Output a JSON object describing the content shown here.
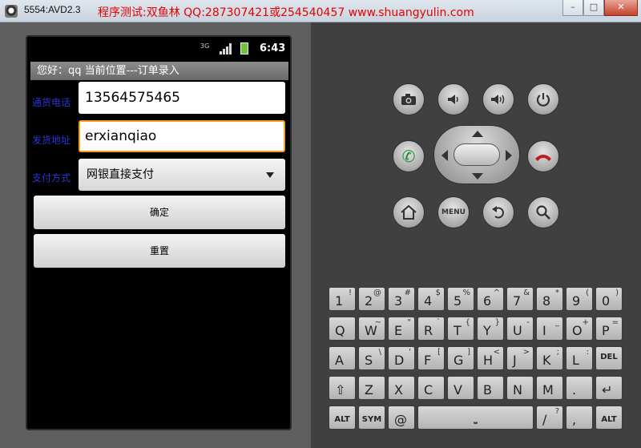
{
  "window": {
    "title": "5554:AVD2.3",
    "watermark": "程序测试:双鱼林 QQ:287307421或254540457 www.shuangyulin.com",
    "minimize": "–",
    "maximize": "□",
    "close": "✕"
  },
  "status_bar": {
    "network": "3G",
    "time": "6:43"
  },
  "app": {
    "title": "您好：qq   当前位置---订单录入",
    "phone_label": "通货电话",
    "phone_value": "13564575465",
    "address_label": "发货地址",
    "address_value": "erxianqiao",
    "payment_label": "支付方式",
    "payment_selected": "网银直接支付",
    "confirm_label": "确定",
    "reset_label": "重置"
  },
  "controls": {
    "menu_label": "MENU",
    "camera_icon": "camera-icon",
    "volume_down_icon": "volume-down-icon",
    "volume_up_icon": "volume-up-icon",
    "power_icon": "power-icon",
    "call_icon": "call-icon",
    "end_call_icon": "end-call-icon",
    "home_icon": "home-icon",
    "back_icon": "back-icon",
    "search_icon": "search-icon"
  },
  "keyboard": {
    "row1": [
      [
        "1",
        "!"
      ],
      [
        "2",
        "@"
      ],
      [
        "3",
        "#"
      ],
      [
        "4",
        "$"
      ],
      [
        "5",
        "%"
      ],
      [
        "6",
        "^"
      ],
      [
        "7",
        "&"
      ],
      [
        "8",
        "*"
      ],
      [
        "9",
        "("
      ],
      [
        "0",
        ")"
      ]
    ],
    "row2": [
      [
        "Q",
        ""
      ],
      [
        "W",
        "~"
      ],
      [
        "E",
        "\""
      ],
      [
        "R",
        "`"
      ],
      [
        "T",
        "{"
      ],
      [
        "Y",
        "}"
      ],
      [
        "U",
        "-"
      ],
      [
        "I",
        "_"
      ],
      [
        "O",
        "+"
      ],
      [
        "P",
        "="
      ]
    ],
    "row3": [
      [
        "A",
        ""
      ],
      [
        "S",
        "\\"
      ],
      [
        "D",
        "'"
      ],
      [
        "F",
        "["
      ],
      [
        "G",
        "]"
      ],
      [
        "H",
        "<"
      ],
      [
        "J",
        ">"
      ],
      [
        "K",
        ";"
      ],
      [
        "L",
        ":"
      ],
      [
        "DEL",
        ""
      ]
    ],
    "row4": [
      [
        "⇧",
        ""
      ],
      [
        "Z",
        ""
      ],
      [
        "X",
        ""
      ],
      [
        "C",
        ""
      ],
      [
        "V",
        ""
      ],
      [
        "B",
        ""
      ],
      [
        "N",
        ""
      ],
      [
        "M",
        ""
      ],
      [
        ".",
        ""
      ],
      [
        "↵",
        ""
      ]
    ],
    "row5": {
      "alt_left": "ALT",
      "sym": "SYM",
      "at": "@",
      "space": "⎵",
      "slash": "/",
      "slash_alt": "?",
      "comma": ",",
      "alt_right": "ALT"
    }
  }
}
